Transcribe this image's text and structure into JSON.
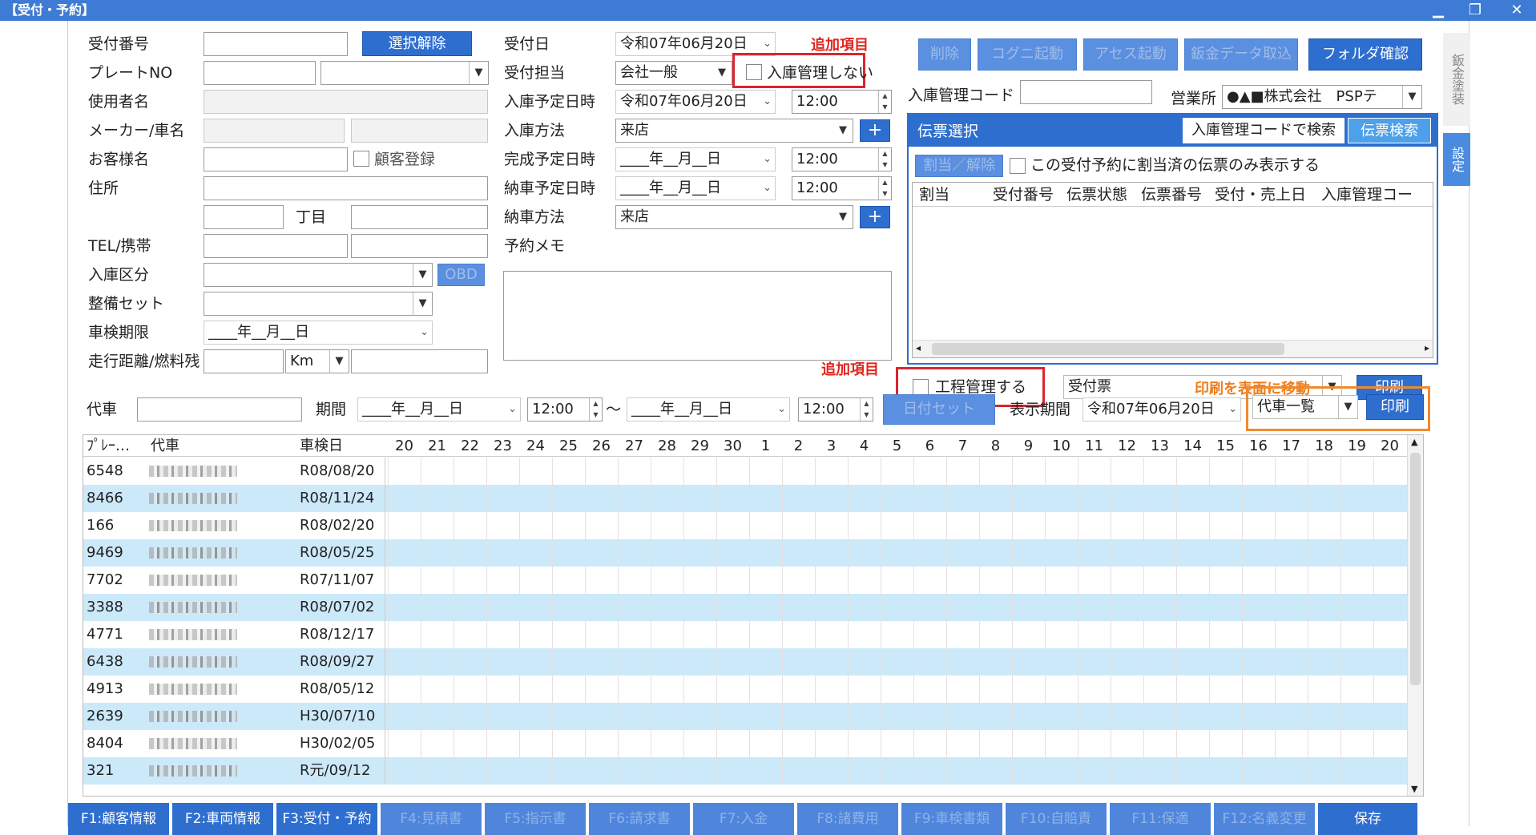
{
  "window": {
    "title": "【受付・予約】",
    "min": "▁",
    "restore": "❐",
    "close": "✕"
  },
  "form": {
    "uketsuke_no": "受付番号",
    "clear_btn": "選択解除",
    "plate_no": "プレートNO",
    "user_name": "使用者名",
    "maker": "メーカー/車名",
    "customer": "お客様名",
    "customer_reg": "顧客登録",
    "address": "住所",
    "chome": "丁目",
    "tel": "TEL/携帯",
    "nyuko_kubun": "入庫区分",
    "obd": "OBD",
    "seibi_set": "整備セット",
    "shaken_kigen": "車検期限",
    "shaken_kigen_val": "____年__月__日",
    "mileage": "走行距離/燃料残",
    "unit": "Km"
  },
  "mid": {
    "uketsuke_bi": "受付日",
    "uketsuke_bi_val": "令和07年06月20日",
    "added1": "追加項目",
    "tanto": "受付担当",
    "tanto_val": "会社一般",
    "no_manage": "入庫管理しない",
    "nyuko_yotei": "入庫予定日時",
    "nyuko_yotei_val": "令和07年06月20日",
    "time1": "12:00",
    "nyuko_hoho": "入庫方法",
    "nyuko_hoho_val": "来店",
    "kansei": "完成予定日時",
    "kansei_val": "____年__月__日",
    "time2": "12:00",
    "nosha": "納車予定日時",
    "nosha_val": "____年__月__日",
    "time3": "12:00",
    "nosha_hoho": "納車方法",
    "nosha_hoho_val": "来店",
    "memo": "予約メモ",
    "added2": "追加項目",
    "plus": "+"
  },
  "right": {
    "btns": [
      "削除",
      "コグニ起動",
      "アセス起動",
      "鈑金データ取込",
      "フォルダ確認"
    ],
    "code_lbl": "入庫管理コード",
    "office_lbl": "営業所",
    "office_val": "●▲■株式会社　PSPテ",
    "denpyo_title": "伝票選択",
    "search_code_btn": "入庫管理コードで検索",
    "search_btn": "伝票検索",
    "assign_btn": "割当／解除",
    "only_assigned": "この受付予約に割当済の伝票のみ表示する",
    "cols": [
      "割当",
      "受付番号",
      "伝票状態",
      "伝票番号",
      "受付・売上日",
      "入庫管理コー"
    ],
    "process": "工程管理する",
    "print_type": "受付票",
    "move_print": "印刷を表面に移動",
    "print": "印刷"
  },
  "side_tabs": [
    "鈑金塗装",
    "設定"
  ],
  "daisha": {
    "lbl": "代車",
    "period": "期間",
    "from_date": "____年__月__日",
    "from_time": "12:00",
    "tilde": "～",
    "to_date": "____年__月__日",
    "to_time": "12:00",
    "date_set": "日付セット",
    "disp_period": "表示期間",
    "disp_val": "令和07年06月20日",
    "list": "代車一覧",
    "print": "印刷"
  },
  "grid": {
    "h_plate": "ﾌﾟﾚｰ…",
    "h_car": "代車",
    "h_shaken": "車検日",
    "days": [
      "20",
      "21",
      "22",
      "23",
      "24",
      "25",
      "26",
      "27",
      "28",
      "29",
      "30",
      "1",
      "2",
      "3",
      "4",
      "5",
      "6",
      "7",
      "8",
      "9",
      "10",
      "11",
      "12",
      "13",
      "14",
      "15",
      "16",
      "17",
      "18",
      "19",
      "20"
    ],
    "rows": [
      {
        "plate": "6548",
        "shaken": "R08/08/20"
      },
      {
        "plate": "8466",
        "shaken": "R08/11/24"
      },
      {
        "plate": "166",
        "shaken": "R08/02/20"
      },
      {
        "plate": "9469",
        "shaken": "R08/05/25"
      },
      {
        "plate": "7702",
        "shaken": "R07/11/07"
      },
      {
        "plate": "3388",
        "shaken": "R08/07/02"
      },
      {
        "plate": "4771",
        "shaken": "R08/12/17"
      },
      {
        "plate": "6438",
        "shaken": "R08/09/27"
      },
      {
        "plate": "4913",
        "shaken": "R08/05/12"
      },
      {
        "plate": "2639",
        "shaken": "H30/07/10"
      },
      {
        "plate": "8404",
        "shaken": "H30/02/05"
      },
      {
        "plate": "321",
        "shaken": "R元/09/12"
      }
    ]
  },
  "fkeys": [
    {
      "label": "F1:顧客情報",
      "on": true
    },
    {
      "label": "F2:車両情報",
      "on": true
    },
    {
      "label": "F3:受付・予約",
      "on": true
    },
    {
      "label": "F4:見積書",
      "on": false
    },
    {
      "label": "F5:指示書",
      "on": false
    },
    {
      "label": "F6:請求書",
      "on": false
    },
    {
      "label": "F7:入金",
      "on": false
    },
    {
      "label": "F8:諸費用",
      "on": false
    },
    {
      "label": "F9:車検書類",
      "on": false
    },
    {
      "label": "F10:自賠責",
      "on": false
    },
    {
      "label": "F11:保適",
      "on": false
    },
    {
      "label": "F12:名義変更",
      "on": false
    },
    {
      "label": "保存",
      "on": true
    }
  ]
}
